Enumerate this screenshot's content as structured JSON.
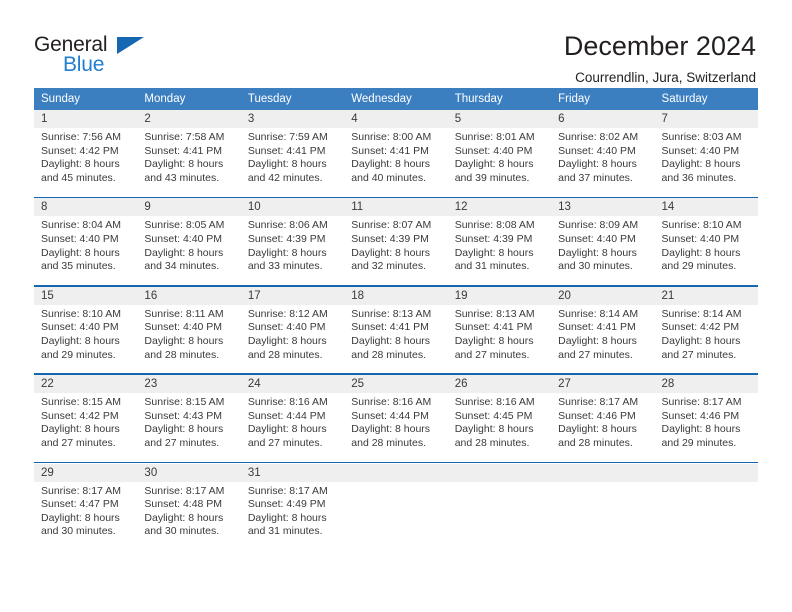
{
  "logo": {
    "word_primary": "General",
    "word_secondary": "Blue",
    "triangle_color": "#1667b2",
    "primary_color": "#231f20",
    "secondary_color": "#1f7fd0"
  },
  "header": {
    "title": "December 2024",
    "subtitle": "Courrendlin, Jura, Switzerland"
  },
  "theme": {
    "header_bg": "#3c7fc1",
    "row_separator": "#1667b2",
    "daynum_bg": "#efefef",
    "text": "#3a3a3a"
  },
  "weekdays": [
    "Sunday",
    "Monday",
    "Tuesday",
    "Wednesday",
    "Thursday",
    "Friday",
    "Saturday"
  ],
  "weeks": [
    {
      "days": [
        {
          "num": "1",
          "sunrise": "Sunrise: 7:56 AM",
          "sunset": "Sunset: 4:42 PM",
          "daylight1": "Daylight: 8 hours",
          "daylight2": "and 45 minutes."
        },
        {
          "num": "2",
          "sunrise": "Sunrise: 7:58 AM",
          "sunset": "Sunset: 4:41 PM",
          "daylight1": "Daylight: 8 hours",
          "daylight2": "and 43 minutes."
        },
        {
          "num": "3",
          "sunrise": "Sunrise: 7:59 AM",
          "sunset": "Sunset: 4:41 PM",
          "daylight1": "Daylight: 8 hours",
          "daylight2": "and 42 minutes."
        },
        {
          "num": "4",
          "sunrise": "Sunrise: 8:00 AM",
          "sunset": "Sunset: 4:41 PM",
          "daylight1": "Daylight: 8 hours",
          "daylight2": "and 40 minutes."
        },
        {
          "num": "5",
          "sunrise": "Sunrise: 8:01 AM",
          "sunset": "Sunset: 4:40 PM",
          "daylight1": "Daylight: 8 hours",
          "daylight2": "and 39 minutes."
        },
        {
          "num": "6",
          "sunrise": "Sunrise: 8:02 AM",
          "sunset": "Sunset: 4:40 PM",
          "daylight1": "Daylight: 8 hours",
          "daylight2": "and 37 minutes."
        },
        {
          "num": "7",
          "sunrise": "Sunrise: 8:03 AM",
          "sunset": "Sunset: 4:40 PM",
          "daylight1": "Daylight: 8 hours",
          "daylight2": "and 36 minutes."
        }
      ]
    },
    {
      "days": [
        {
          "num": "8",
          "sunrise": "Sunrise: 8:04 AM",
          "sunset": "Sunset: 4:40 PM",
          "daylight1": "Daylight: 8 hours",
          "daylight2": "and 35 minutes."
        },
        {
          "num": "9",
          "sunrise": "Sunrise: 8:05 AM",
          "sunset": "Sunset: 4:40 PM",
          "daylight1": "Daylight: 8 hours",
          "daylight2": "and 34 minutes."
        },
        {
          "num": "10",
          "sunrise": "Sunrise: 8:06 AM",
          "sunset": "Sunset: 4:39 PM",
          "daylight1": "Daylight: 8 hours",
          "daylight2": "and 33 minutes."
        },
        {
          "num": "11",
          "sunrise": "Sunrise: 8:07 AM",
          "sunset": "Sunset: 4:39 PM",
          "daylight1": "Daylight: 8 hours",
          "daylight2": "and 32 minutes."
        },
        {
          "num": "12",
          "sunrise": "Sunrise: 8:08 AM",
          "sunset": "Sunset: 4:39 PM",
          "daylight1": "Daylight: 8 hours",
          "daylight2": "and 31 minutes."
        },
        {
          "num": "13",
          "sunrise": "Sunrise: 8:09 AM",
          "sunset": "Sunset: 4:40 PM",
          "daylight1": "Daylight: 8 hours",
          "daylight2": "and 30 minutes."
        },
        {
          "num": "14",
          "sunrise": "Sunrise: 8:10 AM",
          "sunset": "Sunset: 4:40 PM",
          "daylight1": "Daylight: 8 hours",
          "daylight2": "and 29 minutes."
        }
      ]
    },
    {
      "days": [
        {
          "num": "15",
          "sunrise": "Sunrise: 8:10 AM",
          "sunset": "Sunset: 4:40 PM",
          "daylight1": "Daylight: 8 hours",
          "daylight2": "and 29 minutes."
        },
        {
          "num": "16",
          "sunrise": "Sunrise: 8:11 AM",
          "sunset": "Sunset: 4:40 PM",
          "daylight1": "Daylight: 8 hours",
          "daylight2": "and 28 minutes."
        },
        {
          "num": "17",
          "sunrise": "Sunrise: 8:12 AM",
          "sunset": "Sunset: 4:40 PM",
          "daylight1": "Daylight: 8 hours",
          "daylight2": "and 28 minutes."
        },
        {
          "num": "18",
          "sunrise": "Sunrise: 8:13 AM",
          "sunset": "Sunset: 4:41 PM",
          "daylight1": "Daylight: 8 hours",
          "daylight2": "and 28 minutes."
        },
        {
          "num": "19",
          "sunrise": "Sunrise: 8:13 AM",
          "sunset": "Sunset: 4:41 PM",
          "daylight1": "Daylight: 8 hours",
          "daylight2": "and 27 minutes."
        },
        {
          "num": "20",
          "sunrise": "Sunrise: 8:14 AM",
          "sunset": "Sunset: 4:41 PM",
          "daylight1": "Daylight: 8 hours",
          "daylight2": "and 27 minutes."
        },
        {
          "num": "21",
          "sunrise": "Sunrise: 8:14 AM",
          "sunset": "Sunset: 4:42 PM",
          "daylight1": "Daylight: 8 hours",
          "daylight2": "and 27 minutes."
        }
      ]
    },
    {
      "days": [
        {
          "num": "22",
          "sunrise": "Sunrise: 8:15 AM",
          "sunset": "Sunset: 4:42 PM",
          "daylight1": "Daylight: 8 hours",
          "daylight2": "and 27 minutes."
        },
        {
          "num": "23",
          "sunrise": "Sunrise: 8:15 AM",
          "sunset": "Sunset: 4:43 PM",
          "daylight1": "Daylight: 8 hours",
          "daylight2": "and 27 minutes."
        },
        {
          "num": "24",
          "sunrise": "Sunrise: 8:16 AM",
          "sunset": "Sunset: 4:44 PM",
          "daylight1": "Daylight: 8 hours",
          "daylight2": "and 27 minutes."
        },
        {
          "num": "25",
          "sunrise": "Sunrise: 8:16 AM",
          "sunset": "Sunset: 4:44 PM",
          "daylight1": "Daylight: 8 hours",
          "daylight2": "and 28 minutes."
        },
        {
          "num": "26",
          "sunrise": "Sunrise: 8:16 AM",
          "sunset": "Sunset: 4:45 PM",
          "daylight1": "Daylight: 8 hours",
          "daylight2": "and 28 minutes."
        },
        {
          "num": "27",
          "sunrise": "Sunrise: 8:17 AM",
          "sunset": "Sunset: 4:46 PM",
          "daylight1": "Daylight: 8 hours",
          "daylight2": "and 28 minutes."
        },
        {
          "num": "28",
          "sunrise": "Sunrise: 8:17 AM",
          "sunset": "Sunset: 4:46 PM",
          "daylight1": "Daylight: 8 hours",
          "daylight2": "and 29 minutes."
        }
      ]
    },
    {
      "days": [
        {
          "num": "29",
          "sunrise": "Sunrise: 8:17 AM",
          "sunset": "Sunset: 4:47 PM",
          "daylight1": "Daylight: 8 hours",
          "daylight2": "and 30 minutes."
        },
        {
          "num": "30",
          "sunrise": "Sunrise: 8:17 AM",
          "sunset": "Sunset: 4:48 PM",
          "daylight1": "Daylight: 8 hours",
          "daylight2": "and 30 minutes."
        },
        {
          "num": "31",
          "sunrise": "Sunrise: 8:17 AM",
          "sunset": "Sunset: 4:49 PM",
          "daylight1": "Daylight: 8 hours",
          "daylight2": "and 31 minutes."
        },
        {
          "num": "",
          "sunrise": "",
          "sunset": "",
          "daylight1": "",
          "daylight2": ""
        },
        {
          "num": "",
          "sunrise": "",
          "sunset": "",
          "daylight1": "",
          "daylight2": ""
        },
        {
          "num": "",
          "sunrise": "",
          "sunset": "",
          "daylight1": "",
          "daylight2": ""
        },
        {
          "num": "",
          "sunrise": "",
          "sunset": "",
          "daylight1": "",
          "daylight2": ""
        }
      ]
    }
  ]
}
